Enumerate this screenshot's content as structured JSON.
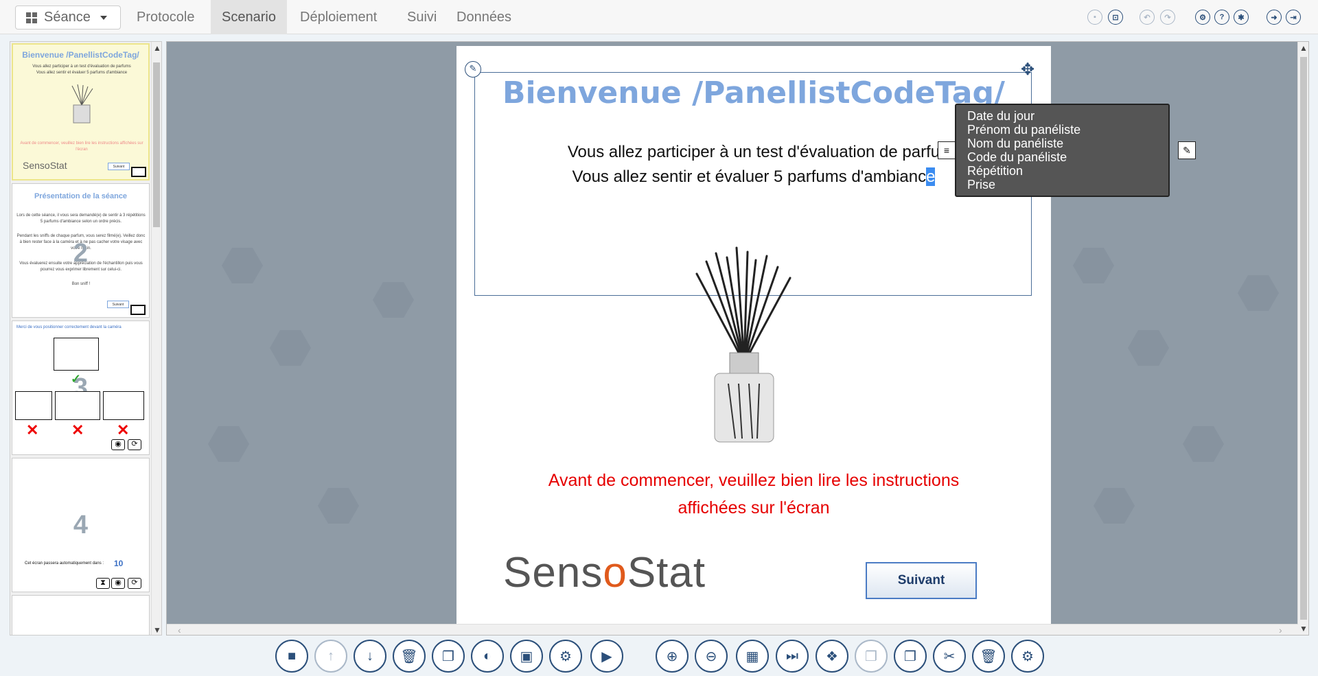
{
  "header": {
    "seance_label": "Séance",
    "tabs": [
      {
        "label": "Protocole",
        "active": false
      },
      {
        "label": "Scenario",
        "active": true
      },
      {
        "label": "Déploiement",
        "active": false
      },
      {
        "label": "Suivi",
        "active": false
      },
      {
        "label": "Données",
        "active": false
      }
    ],
    "right_icons": [
      "save-icon",
      "unlock-icon",
      "undo-icon",
      "redo-icon",
      "settings-share-icon",
      "help-icon",
      "bug-icon",
      "export-icon",
      "logout-icon"
    ]
  },
  "thumbnails": {
    "slide1": {
      "title": "Bienvenue /PanellistCodeTag/",
      "line1": "Vous allez participer à un test d'évaluation de parfums",
      "line2": "Vous allez sentir et évaluer 5 parfums d'ambiance",
      "red": "Avant de commencer, veuillez bien lire les instructions affichées sur l'écran",
      "logo": "SensoStat",
      "btn": "Suivant"
    },
    "slide2": {
      "title": "Présentation de la séance",
      "p1": "Lors de cette séance, il vous sera demandé(e) de sentir à 3 répétitions 5 parfums d'ambiance selon un ordre précis.",
      "p2": "Pendant les sniffs de chaque parfum, vous serez filmé(e). Veillez donc à bien rester face à la caméra et à ne pas cacher votre visage avec votre main.",
      "p3": "Vous évaluerez ensuite votre appréciation de l'échantillon puis vous pourrez vous exprimer librement sur celui-ci.",
      "p4": "Bon sniff !",
      "num": "2",
      "btn": "Suivant"
    },
    "slide3": {
      "title": "Merci de vous positionner correctement devant la caméra",
      "num": "3"
    },
    "slide4": {
      "num": "4",
      "text": "Cet écran passera automatiquement dans :",
      "count": "10"
    }
  },
  "slide": {
    "title": "Bienvenue /PanellistCodeTag/",
    "line1": "Vous allez participer à un test d'évaluation de parfu",
    "line2_pre": "Vous allez sentir et évaluer 5 parfums d'ambianc",
    "line2_sel": "e",
    "red_line1": "Avant de commencer, veuillez bien lire les instructions",
    "red_line2": "affichées sur l'écran",
    "logo_pre": "Sens",
    "logo_o": "o",
    "logo_post": "Stat",
    "button": "Suivant"
  },
  "variable_menu": {
    "items": [
      "Date du jour",
      "Prénom du panéliste",
      "Nom du panéliste",
      "Code du panéliste",
      "Répétition",
      "Prise"
    ]
  },
  "toolbar": {
    "buttons": [
      "stop-icon",
      "arrow-up-icon",
      "arrow-down-icon",
      "trash-icon",
      "copy-icon",
      "palette-icon",
      "image-icon",
      "settings-icon",
      "play-icon",
      "zoom-in-icon",
      "zoom-out-icon",
      "grid-icon",
      "step-forward-icon",
      "cubes-icon",
      "paste-icon",
      "copy-icon",
      "cut-icon",
      "trash-icon",
      "settings-icon"
    ]
  }
}
